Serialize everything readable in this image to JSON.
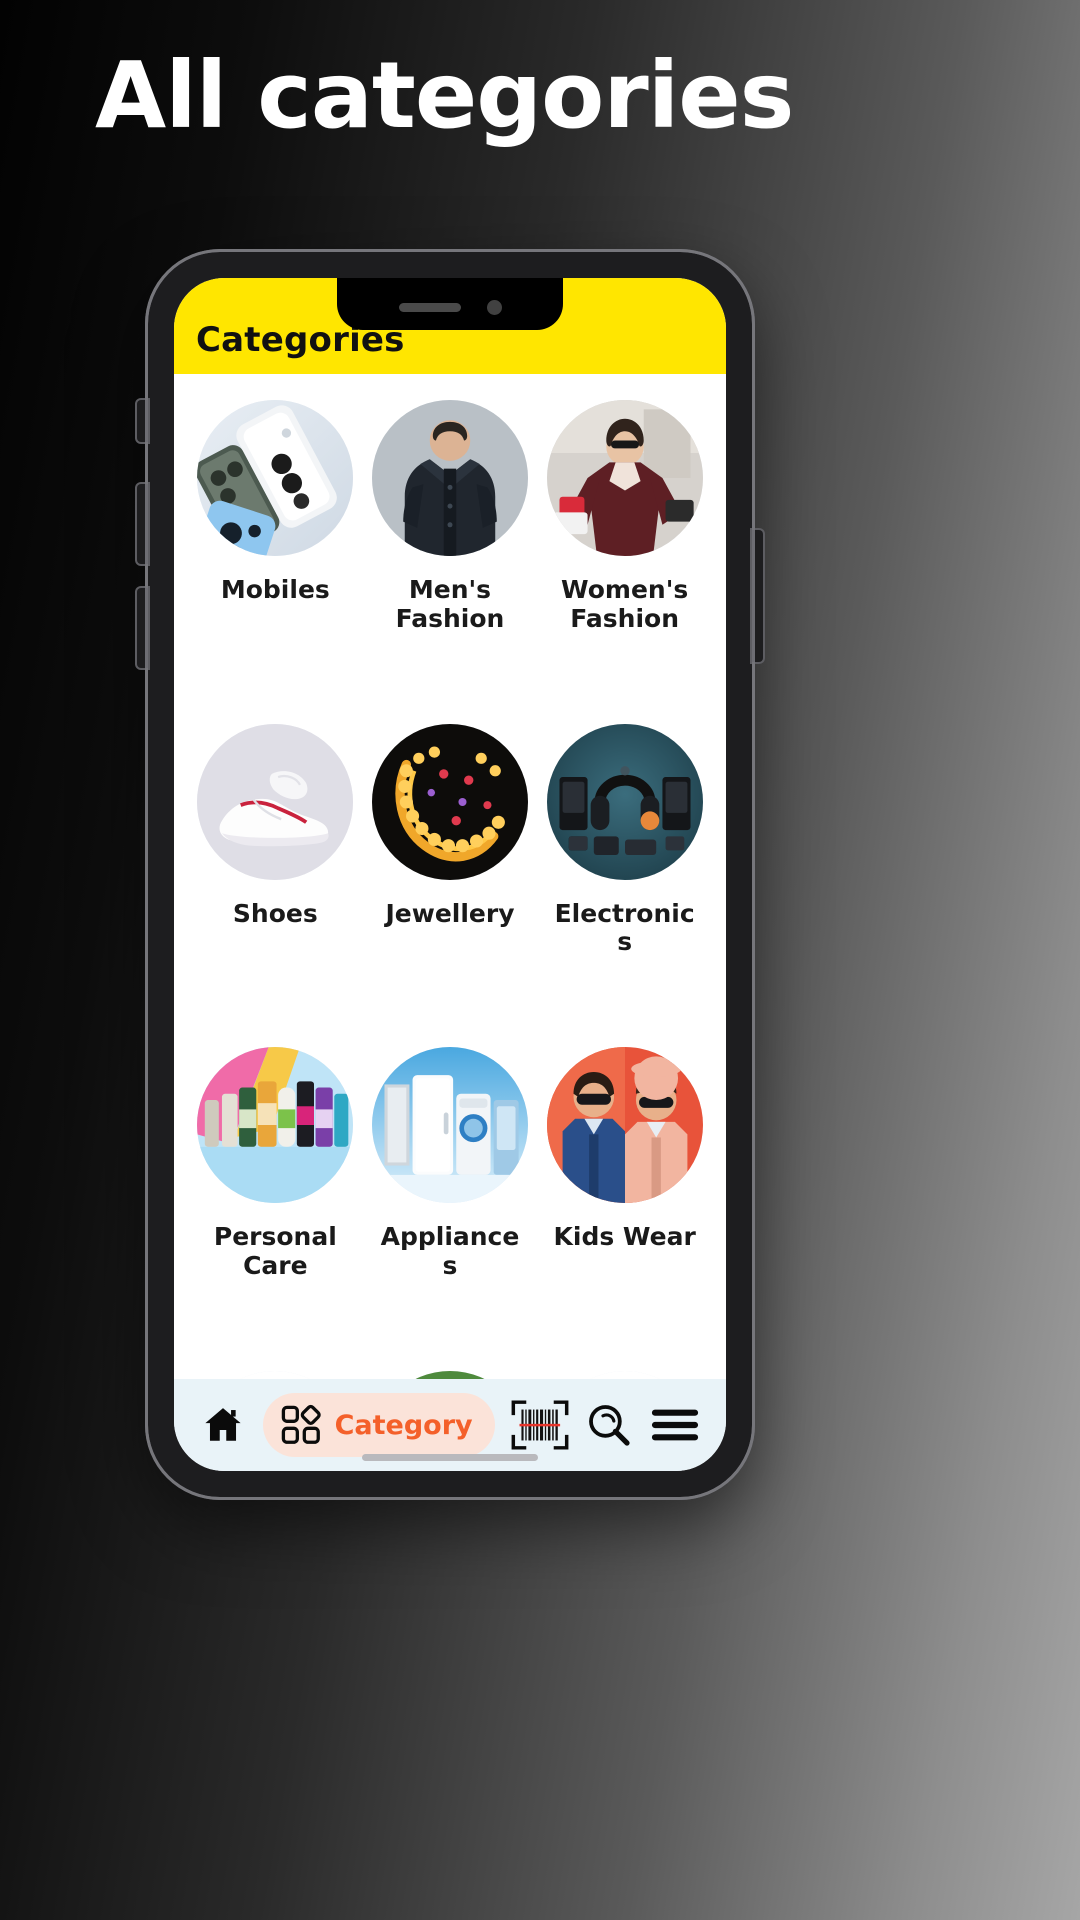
{
  "page": {
    "title": "All categories",
    "background_start": "#000000",
    "background_end": "#a6a6a6"
  },
  "phone": {
    "notch": {
      "speaker": "speaker-grill",
      "camera": "front-camera"
    },
    "home_indicator": "home-indicator"
  },
  "app": {
    "header": {
      "title": "Categories",
      "background": "#ffe600",
      "text_color": "#111111"
    },
    "categories": [
      {
        "label": "Mobiles",
        "icon": "mobiles-thumb"
      },
      {
        "label": "Men's Fashion",
        "icon": "mens-fashion-thumb"
      },
      {
        "label": "Women's Fashion",
        "icon": "womens-fashion-thumb"
      },
      {
        "label": "Shoes",
        "icon": "shoes-thumb"
      },
      {
        "label": "Jewellery",
        "icon": "jewellery-thumb"
      },
      {
        "label": "Electronics",
        "icon": "electronics-thumb"
      },
      {
        "label": "Personal Care",
        "icon": "personal-care-thumb"
      },
      {
        "label": "Appliances",
        "icon": "appliances-thumb"
      },
      {
        "label": "Kids Wear",
        "icon": "kids-wear-thumb"
      },
      {
        "label": "",
        "icon": "grocery-thumb"
      },
      {
        "label": "",
        "icon": "sports-thumb"
      },
      {
        "label": "",
        "icon": "vegetables-thumb"
      }
    ],
    "bottom_nav": {
      "items": [
        {
          "name": "home",
          "icon": "home-icon",
          "label": "",
          "active": false
        },
        {
          "name": "category",
          "icon": "grid-icon",
          "label": "Category",
          "active": true
        },
        {
          "name": "scan",
          "icon": "barcode-icon",
          "label": "",
          "active": false
        },
        {
          "name": "search",
          "icon": "search-icon",
          "label": "",
          "active": false
        },
        {
          "name": "menu",
          "icon": "hamburger-icon",
          "label": "",
          "active": false
        }
      ],
      "active_color": "#f4602a",
      "active_pill_background": "#fbe3d9",
      "background": "#e9f3f8"
    }
  }
}
